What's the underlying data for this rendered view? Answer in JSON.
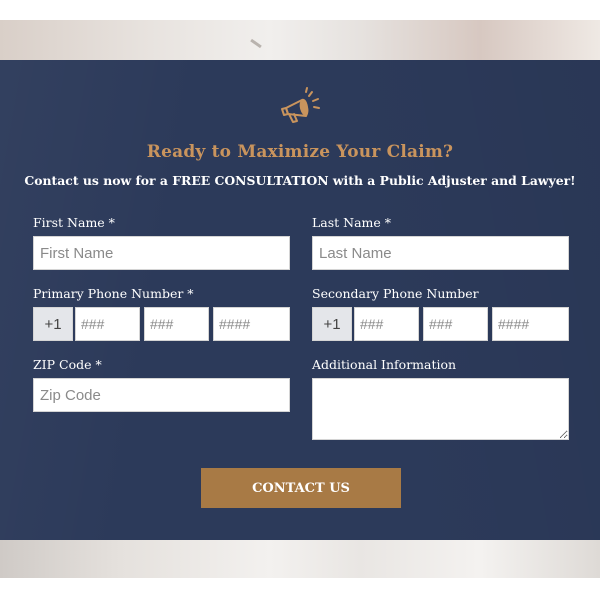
{
  "form": {
    "headline": "Ready to Maximize Your Claim?",
    "subheadline": "Contact us now for a FREE CONSULTATION with a Public Adjuster and Lawyer!",
    "first_name": {
      "label": "First Name *",
      "placeholder": "First Name"
    },
    "last_name": {
      "label": "Last Name *",
      "placeholder": "Last Name"
    },
    "primary_phone": {
      "label": "Primary Phone Number *",
      "prefix": "+1",
      "area_placeholder": "###",
      "exchange_placeholder": "###",
      "line_placeholder": "####"
    },
    "secondary_phone": {
      "label": "Secondary Phone Number",
      "prefix": "+1",
      "area_placeholder": "###",
      "exchange_placeholder": "###",
      "line_placeholder": "####"
    },
    "zip": {
      "label": "ZIP Code *",
      "placeholder": "Zip Code"
    },
    "additional_info": {
      "label": "Additional Information",
      "placeholder": ""
    },
    "submit_label": "CONTACT US"
  },
  "icons": {
    "header_icon": "megaphone-icon"
  },
  "colors": {
    "panel": "#2c3a5a",
    "accent": "#c9945d",
    "button": "#a87a45",
    "text": "#ffffff"
  }
}
